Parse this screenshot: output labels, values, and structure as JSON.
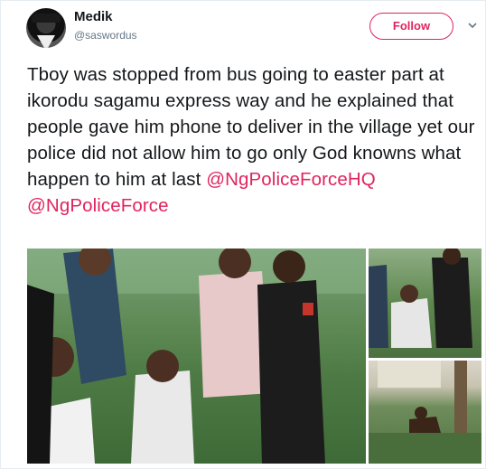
{
  "user": {
    "name": "Medik",
    "handle": "@saswordus"
  },
  "follow_button": {
    "label": "Follow"
  },
  "tweet": {
    "text": "Tboy was stopped from bus going to easter part at ikorodu sagamu express way and he explained that people gave him phone to deliver in the village yet our police did not allow him to go only God knowns what happen to him at last ",
    "mentions": [
      "@NgPoliceForceHQ",
      "@NgPoliceForce"
    ]
  },
  "icons": {
    "avatar": "profile-avatar",
    "more": "chevron-down-icon"
  },
  "colors": {
    "accent": "#e0245e",
    "text": "#14171a",
    "muted": "#657786"
  }
}
